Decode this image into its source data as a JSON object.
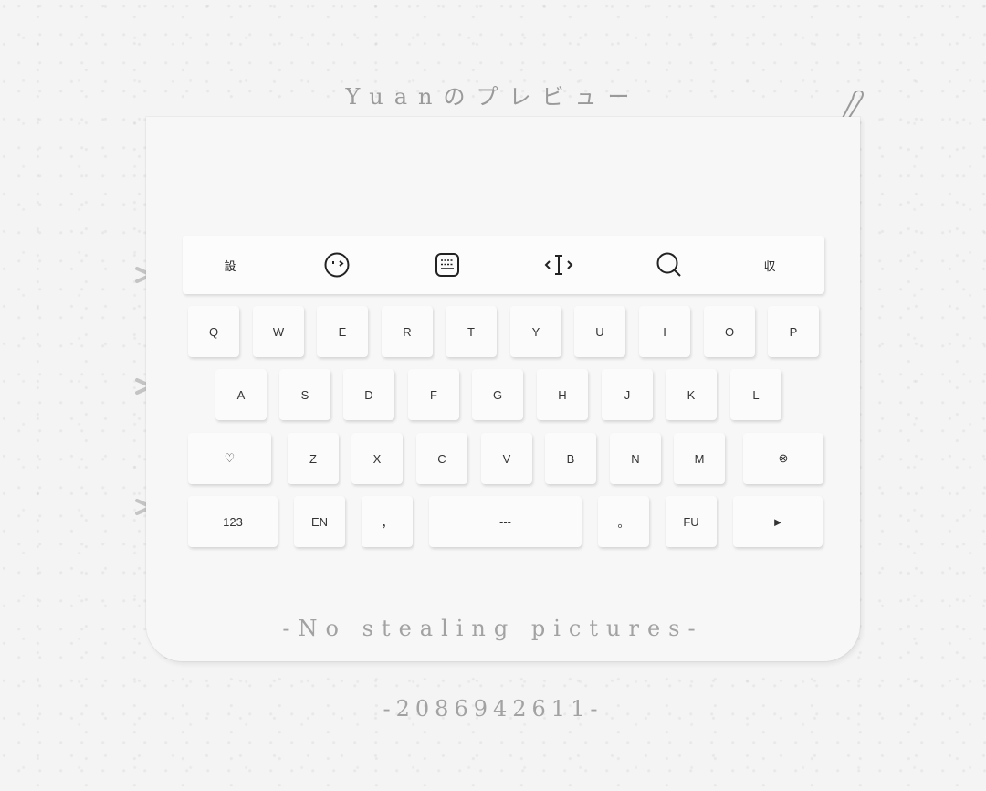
{
  "header": {
    "title": "Yuanのプレビュー"
  },
  "toolbar": {
    "settings_label": "設",
    "emoji_icon": "emoji-icon",
    "clipboard_icon": "clipboard-icon",
    "cursor_icon": "cursor-icon",
    "search_icon": "search-icon",
    "collapse_label": "収"
  },
  "keyboard": {
    "row1": [
      "Q",
      "W",
      "E",
      "R",
      "T",
      "Y",
      "U",
      "I",
      "O",
      "P"
    ],
    "row2": [
      "A",
      "S",
      "D",
      "F",
      "G",
      "H",
      "J",
      "K",
      "L"
    ],
    "row3": {
      "shift_label": "♡",
      "letters": [
        "Z",
        "X",
        "C",
        "V",
        "B",
        "N",
        "M"
      ],
      "delete_label": "⊗"
    },
    "row4": {
      "numbers_label": "123",
      "lang_label": "EN",
      "comma_label": "，",
      "space_label": "---",
      "period_label": "。",
      "fu_label": "FU",
      "enter_label": "►"
    }
  },
  "footer": {
    "notice": "-No stealing pictures-",
    "qq": "-2086942611-"
  },
  "colors": {
    "background": "#f4f4f4",
    "key": "#fbfbfb",
    "watermark_text": "#9a9a9a"
  }
}
